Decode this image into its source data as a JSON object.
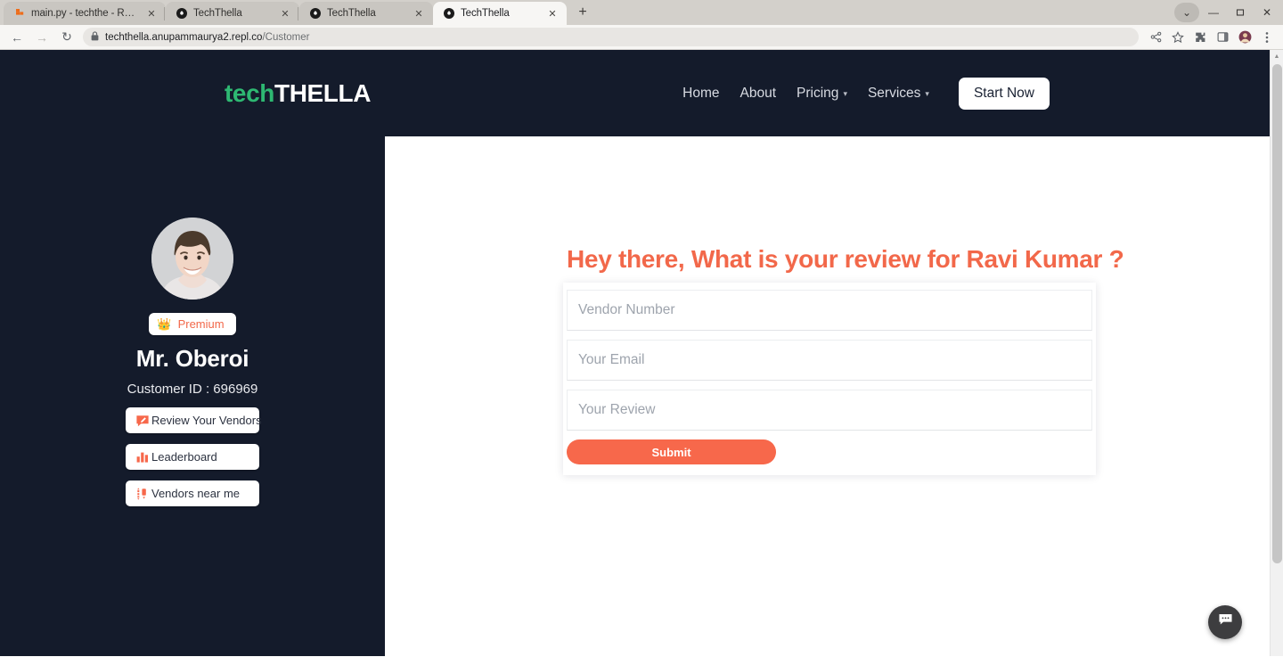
{
  "browser": {
    "tabs": [
      {
        "title": "main.py - techthe - Replit",
        "favicon": "replit-icon",
        "active": false
      },
      {
        "title": "TechThella",
        "favicon": "techthella-icon",
        "active": false
      },
      {
        "title": "TechThella",
        "favicon": "techthella-icon",
        "active": false
      },
      {
        "title": "TechThella",
        "favicon": "techthella-icon",
        "active": true
      }
    ],
    "new_tab_label": "+",
    "window_controls": {
      "chevron": "⌄",
      "minimize": "—",
      "maximize": "❐",
      "close": "✕"
    },
    "toolbar": {
      "back": "←",
      "forward": "→",
      "reload": "↻",
      "lock_icon": "lock-icon",
      "url_host": "techthella.anupammaurya2.repl.co",
      "url_path": "/Customer",
      "share_icon": "share-icon",
      "bookmark_icon": "star-icon",
      "extensions_icon": "puzzle-icon",
      "sidepanel_icon": "sidepanel-icon",
      "profile_icon": "profile-avatar",
      "menu_icon": "kebab-menu-icon"
    }
  },
  "site": {
    "logo": {
      "part1": "tech",
      "part2": "THELLA"
    },
    "nav": [
      {
        "label": "Home",
        "dropdown": false
      },
      {
        "label": "About",
        "dropdown": false
      },
      {
        "label": "Pricing",
        "dropdown": true
      },
      {
        "label": "Services",
        "dropdown": true
      }
    ],
    "cta": "Start Now"
  },
  "sidebar": {
    "avatar": "user-avatar-photo",
    "badge": {
      "icon": "👑",
      "label": "Premium"
    },
    "user_name": "Mr. Oberoi",
    "customer_id": "Customer ID : 696969",
    "buttons": [
      {
        "label": "Review Your Vendors",
        "icon": "review-icon"
      },
      {
        "label": "Leaderboard",
        "icon": "bar-chart-icon"
      },
      {
        "label": "Vendors near me",
        "icon": "location-pins-icon"
      }
    ]
  },
  "main": {
    "heading": "Hey there, What is your review for Ravi Kumar ?",
    "fields": [
      {
        "placeholder": "Vendor Number",
        "value": ""
      },
      {
        "placeholder": "Your Email",
        "value": ""
      },
      {
        "placeholder": "Your Review",
        "value": ""
      }
    ],
    "submit_label": "Submit"
  },
  "chat_widget": {
    "icon": "chat-bubble-icon"
  },
  "colors": {
    "dark_navy": "#141b2b",
    "accent_orange": "#f7684b",
    "logo_green": "#2eb872"
  }
}
